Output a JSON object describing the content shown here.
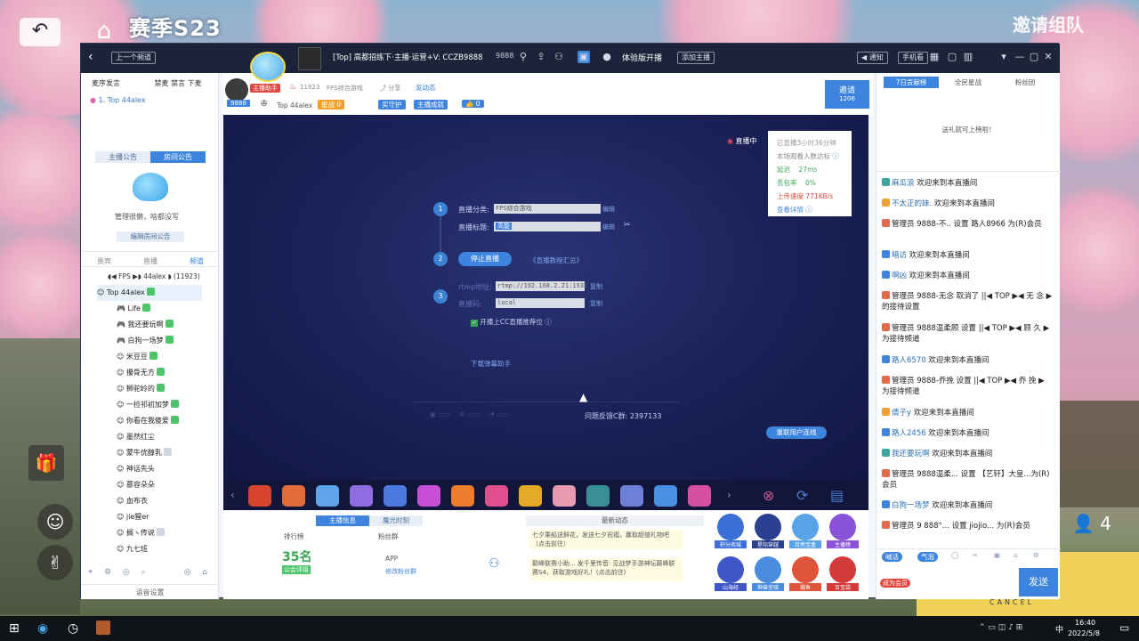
{
  "game": {
    "season_title": "赛季S23",
    "invite_team": "邀请组队",
    "side_count": "4",
    "cancel_label": "CANCEL"
  },
  "titlebar": {
    "back_label": "上一个频道",
    "room_title": "[Top] 高都招练下·主播·运营+V: CCZB9888",
    "room_id": "9888",
    "experience_label": "体验版开播",
    "add_anchor_label": "添加主播",
    "notify_label": "通知",
    "phone_label": "手机看"
  },
  "left_panel": {
    "tabs": [
      "麦序发言",
      "禁麦",
      "禁言",
      "下麦"
    ],
    "mic_user": "1. Top 44alex",
    "notice_tabs": [
      "主播公告",
      "房间公告"
    ],
    "welcome_text": "管理很懒，啥都没写",
    "edit_notice_label": "编辑房间公告",
    "list_tabs": [
      "贵宾",
      "直播",
      "频道"
    ],
    "channel_title": "◖◀ FPS ▶◗ 44alex ◗ (11923)",
    "users": [
      "Top 44alex",
      "Life",
      "我还要玩啊",
      "白狗一场梦",
      "米豆豆",
      "攥骨无方",
      "狮驼岭的",
      "一捡祁初加梦",
      "你看在我傻爱",
      "墨然红尘",
      "蒙牛优醇乳",
      "神话先头",
      "慕容朵朵",
      "血布衣",
      "jie猩er",
      "搁ヽ传说",
      "九七班"
    ],
    "footer_label": "语音设置"
  },
  "info_strip": {
    "anchor_tag": "主播助手",
    "anchor_count": "11923",
    "category": "FPS综合游戏",
    "share_label": "分享",
    "publish_label": "发动态",
    "room_num": "9888",
    "anchor_name": "Top 44alex",
    "star_label": "星战 0",
    "guard_label": "买守护",
    "task_label": "主播成就",
    "likes": "0",
    "invite_label": "邀请",
    "invite_count": "1206"
  },
  "stage": {
    "live_label": "直播中",
    "stats": {
      "duration": "已直播3小时36分钟",
      "viewers_label": "本场观看人数达标",
      "delay_label": "延迟",
      "delay_value": "27ms",
      "loss_label": "丢包率",
      "loss_value": "0%",
      "upload_label": "上传速度",
      "upload_value": "771KB/s",
      "detail_label": "查看详情"
    },
    "category_label": "直播分类:",
    "category_value": "FPS综合游戏",
    "title_label": "直播标题:",
    "title_value": "高能",
    "edit_label": "编辑",
    "stop_label": "停止直播",
    "tutorial_label": "《直播教程汇总》",
    "rtmp_label": "rtmp地址:",
    "rtmp_value": "rtmp://192.168.2.21:1935",
    "stream_label": "直播码:",
    "stream_value": "local",
    "copy_label": "复制",
    "recommend_label": "开播上CC直播推荐位",
    "download_label": "下载弹幕助手",
    "feedback_label": "问题反馈C群: 2397133",
    "contact_label": "重联用户连线"
  },
  "bottom": {
    "tabs": [
      "主播信息",
      "魔光时刻"
    ],
    "dynamic_label": "最新动态",
    "rank_label": "排行榜",
    "fans_label": "粉丝群",
    "rank_value": "35名",
    "rank_sub": "公会评级",
    "app_label": "APP",
    "fans_sub": "修改粉丝群",
    "news": [
      "七夕乘船送鲜花，发送七夕祝福，赢取超值礼物吧（点击前往）",
      "巅峰联赛小助... 发千里传音: 见战梦手游神坛巅峰联赛S4，获取游戏好礼！(点击前往)"
    ],
    "activities": [
      "积分商城",
      "星际穿越",
      "月亮宝盒",
      "主播榜",
      "山海经",
      "神兽坐骑",
      "捕鱼",
      "百宝袋"
    ]
  },
  "right_panel": {
    "tabs": [
      "7日贡献榜",
      "全民星战",
      "粉丝团"
    ],
    "empty_label": "送礼就可上榜啦！",
    "chat": [
      {
        "name": "麻瓜浪",
        "text": "欢迎来到本直播间"
      },
      {
        "name": "不太正的妹.",
        "text": "欢迎来到本直播间"
      },
      {
        "name": "管理员 9888-不..",
        "text": "设置 路人8966 为(R)会员"
      },
      {
        "name": "暗访",
        "text": "欢迎来到本直播间"
      },
      {
        "name": "啊凶",
        "text": "欢迎来到本直播间"
      },
      {
        "name": "管理员 9888-无念",
        "text": "取消了 ||◀ TOP ▶◀ 无 念 ▶ 的接待设置"
      },
      {
        "name": "管理员 9888温柔顾",
        "text": "设置 ||◀ TOP ▶◀ 顾 久 ▶ 为接待频道"
      },
      {
        "name": "路人6570",
        "text": "欢迎来到本直播间"
      },
      {
        "name": "管理员 9888-乔挽",
        "text": "设置 ||◀ TOP ▶◀ 乔 挽 ▶ 为接待频道"
      },
      {
        "name": "倩子y",
        "text": "欢迎来到本直播间"
      },
      {
        "name": "路人2456",
        "text": "欢迎来到本直播间"
      },
      {
        "name": "我还要玩啊",
        "text": "欢迎来到本直播间"
      },
      {
        "name": "管理员 9888温柔...",
        "text": "设置 【艺轩】大皇...为(R)会员"
      },
      {
        "name": "白狗一场梦",
        "text": "欢迎来到本直播间"
      },
      {
        "name": "管理员 9 888°...",
        "text": "设置 jiojio... 为(R)会员"
      }
    ],
    "tool_labels": [
      "喊话",
      "气泡"
    ],
    "send_label": "发送",
    "become_label": "成为会员"
  },
  "taskbar": {
    "time": "16:40",
    "date": "2022/5/8",
    "lang": "中"
  },
  "colors": {
    "accent": "#3d84de",
    "dark": "#1b2438",
    "stage": "#1b2259"
  }
}
